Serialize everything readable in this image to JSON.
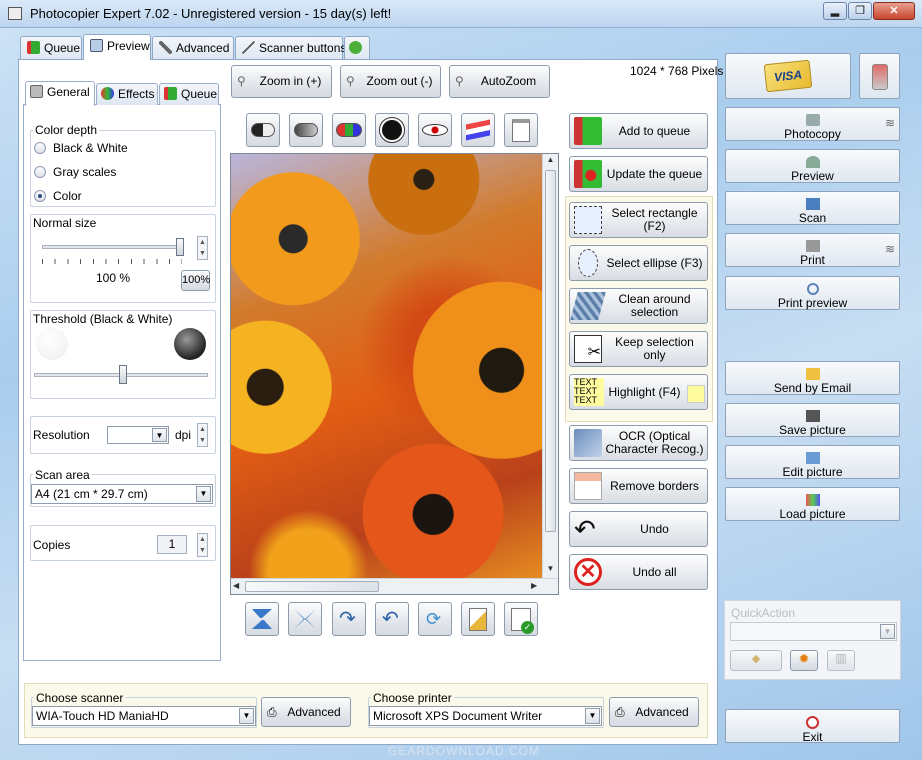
{
  "window": {
    "title": "Photocopier Expert 7.02 - Unregistered version - 15 day(s) left!",
    "controls": [
      "▂",
      "❐",
      "✕"
    ]
  },
  "main_tabs": [
    {
      "label": "Queue"
    },
    {
      "label": "Preview"
    },
    {
      "label": "Advanced"
    },
    {
      "label": "Scanner buttons"
    },
    {
      "label": ""
    }
  ],
  "sub_tabs": [
    {
      "label": "General"
    },
    {
      "label": "Effects"
    },
    {
      "label": "Queue"
    }
  ],
  "left": {
    "color_depth": {
      "label": "Color depth",
      "options": [
        "Black & White",
        "Gray scales",
        "Color"
      ],
      "selected": "Color"
    },
    "normal_size": {
      "label": "Normal size",
      "value_text": "100 %",
      "button": "100%",
      "level": 1.0
    },
    "threshold": {
      "label": "Threshold (Black & White)",
      "level": 0.5
    },
    "resolution": {
      "label": "Resolution",
      "value": "",
      "unit": "dpi"
    },
    "scan_area": {
      "label": "Scan area",
      "value": "A4  (21 cm * 29.7 cm)"
    },
    "copies": {
      "label": "Copies",
      "value": "1"
    }
  },
  "zoom": {
    "zoom_in": "Zoom in (+)",
    "zoom_out": "Zoom out (-)",
    "autozoom": "AutoZoom",
    "dimensions": "1024 * 768 Pixels"
  },
  "actions": [
    {
      "label": "Add to queue",
      "icon": "book-green-icon"
    },
    {
      "label": "Update the queue",
      "icon": "book-red-icon"
    },
    {
      "label": "Select rectangle (F2)",
      "icon": "select-rectangle-icon"
    },
    {
      "label": "Select ellipse (F3)",
      "icon": "select-ellipse-icon"
    },
    {
      "label": "Clean around selection",
      "icon": "clean-around-icon"
    },
    {
      "label": "Keep selection only",
      "icon": "scissors-icon"
    },
    {
      "label": "Highlight (F4)",
      "icon": "highlight-text-icon",
      "icon_text": "TEXT"
    },
    {
      "label": "OCR (Optical Character Recog.)",
      "icon": "ocr-icon"
    },
    {
      "label": "Remove borders",
      "icon": "remove-borders-icon"
    },
    {
      "label": "Undo",
      "icon": "undo-arrow-icon"
    },
    {
      "label": "Undo all",
      "icon": "undo-all-icon"
    }
  ],
  "scanner": {
    "label": "Choose scanner",
    "value": "WIA-Touch HD ManiaHD",
    "advanced": "Advanced"
  },
  "printer": {
    "label": "Choose printer",
    "value": "Microsoft XPS Document Writer",
    "advanced": "Advanced"
  },
  "right": {
    "buttons": [
      {
        "label": "Photocopy"
      },
      {
        "label": "Preview"
      },
      {
        "label": "Scan"
      },
      {
        "label": "Print"
      },
      {
        "label": "Print preview"
      },
      {
        "label": "Send by Email"
      },
      {
        "label": "Save picture"
      },
      {
        "label": "Edit picture"
      },
      {
        "label": "Load picture"
      }
    ],
    "visa_label": "VISA",
    "quickaction_label": "QuickAction",
    "exit": "Exit"
  },
  "watermark": "GEARDOWNLOAD.COM",
  "colors": {
    "accent": "#2b4d7a",
    "highlight": "#fffca0"
  }
}
